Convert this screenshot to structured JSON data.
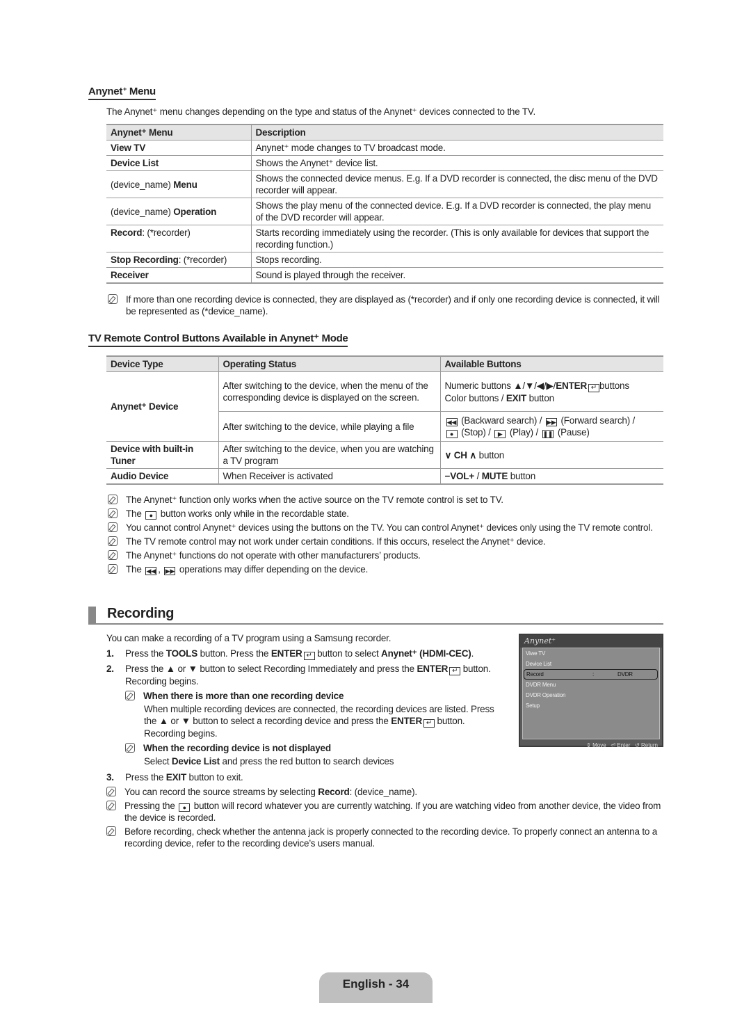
{
  "anynet_menu": {
    "title": "Anynet",
    "title_suffix": "Menu",
    "intro": "The Anynet⁺ menu changes depending on the type and status of the Anynet⁺ devices connected to the TV.",
    "table": {
      "headers": [
        "Anynet⁺ Menu",
        "Description"
      ],
      "rows": [
        {
          "menu_pre": "",
          "menu_bold": "View TV",
          "menu_post": "",
          "desc": "Anynet⁺ mode changes to TV broadcast mode."
        },
        {
          "menu_pre": "",
          "menu_bold": "Device List",
          "menu_post": "",
          "desc": "Shows the Anynet⁺ device list."
        },
        {
          "menu_pre": "(device_name) ",
          "menu_bold": "Menu",
          "menu_post": "",
          "desc": "Shows the connected device menus. E.g. If a DVD recorder is connected, the disc menu of the DVD recorder will appear."
        },
        {
          "menu_pre": "(device_name) ",
          "menu_bold": "Operation",
          "menu_post": "",
          "desc": "Shows the play menu of the connected device. E.g. If a DVD recorder is connected, the play menu of the DVD recorder will appear."
        },
        {
          "menu_pre": "",
          "menu_bold": "Record",
          "menu_post": ": (*recorder)",
          "desc": "Starts recording immediately using the recorder. (This is only available for devices that support the recording function.)"
        },
        {
          "menu_pre": "",
          "menu_bold": "Stop Recording",
          "menu_post": ": (*recorder)",
          "desc": "Stops recording."
        },
        {
          "menu_pre": "",
          "menu_bold": "Receiver",
          "menu_post": "",
          "desc": "Sound is played through the receiver."
        }
      ]
    },
    "note": "If more than one recording device is connected, they are displayed as (*recorder) and if only one recording device is connected, it will be represented as (*device_name)."
  },
  "remote_section": {
    "title": "TV Remote Control Buttons Available in Anynet⁺ Mode",
    "table": {
      "headers": [
        "Device Type",
        "Operating Status",
        "Available Buttons"
      ],
      "anynet_device": "Anynet⁺ Device",
      "status_menu": "After switching to the device, when the menu of the corresponding device is displayed on the screen.",
      "buttons_menu_line1_pre": "Numeric buttons ▲/▼/◀/▶/",
      "buttons_menu_line1_bold": "ENTER",
      "buttons_menu_line1_post": "buttons",
      "buttons_menu_line2_pre": "Color buttons / ",
      "buttons_menu_line2_bold": "EXIT",
      "buttons_menu_line2_post": " button",
      "status_file": "After switching to the device, while playing a file",
      "btn_backward": "(Backward search) /",
      "btn_forward": "(Forward search) /",
      "btn_stop": "(Stop) /",
      "btn_play": "(Play) /",
      "btn_pause": "(Pause)",
      "tuner_device": "Device with built-in Tuner",
      "tuner_status": "After switching to the device, when you are watching a TV program",
      "tuner_ch": "CH",
      "tuner_button": "button",
      "audio_device": "Audio Device",
      "audio_status": "When Receiver is activated",
      "audio_vol": "VOL",
      "audio_sep": " / ",
      "audio_mute": "MUTE",
      "audio_button": " button"
    },
    "notes": [
      "The Anynet⁺ function only works when the active source on the TV remote control is set to TV.",
      "button works only while in the recordable state.",
      "You cannot control Anynet⁺ devices using the buttons on the TV. You can control Anynet⁺ devices only using the TV remote control.",
      "The TV remote control may not work under certain conditions. If this occurs, reselect the Anynet⁺ device.",
      "The Anynet⁺ functions do not operate with other manufacturers’ products.",
      "operations may differ depending on the device."
    ],
    "note_the": "The"
  },
  "recording": {
    "title": "Recording",
    "intro": "You can make a recording of a TV program using a Samsung recorder.",
    "step1": {
      "num": "1.",
      "a": "Press the ",
      "b": "TOOLS",
      "c": " button. Press the ",
      "d": "ENTER",
      "e": " button to select ",
      "f": "Anynet⁺ (HDMI-CEC)",
      "g": "."
    },
    "step2": {
      "num": "2.",
      "a": "Press the ▲ or ▼ button to select Recording Immediately and press the ",
      "b": "ENTER",
      "c": " button. Recording begins."
    },
    "sub1_title": "When there is more than one recording device",
    "sub1_text_a": "When multiple recording devices are connected, the recording devices are listed. Press the ▲ or ▼ button to select a recording device and press the ",
    "sub1_text_b": "ENTER",
    "sub1_text_c": " button. Recording begins.",
    "sub2_title": "When the recording device is not displayed",
    "sub2_text_a": "Select ",
    "sub2_text_b": "Device List",
    "sub2_text_c": " and press the red button to search devices",
    "step3": {
      "num": "3.",
      "a": "Press the ",
      "b": "EXIT",
      "c": " button to exit."
    },
    "note1_a": "You can record the source streams by selecting ",
    "note1_b": "Record",
    "note1_c": ": (device_name).",
    "note2_a": "Pressing the",
    "note2_b": "button will record whatever you are currently watching. If you are watching video from another device, the video from the device is recorded.",
    "note3": "Before recording, check whether the antenna jack is properly connected to the recording device. To properly connect an antenna to a recording device, refer to the recording device’s users manual."
  },
  "osd": {
    "logo": "Anynet⁺",
    "items": [
      "Viwe TV",
      "Device List",
      "Record",
      "DVDR Menu",
      "DVDR Operation",
      "Setup"
    ],
    "selected_sep": ":",
    "selected_value": "DVDR",
    "footer": {
      "move": "Move",
      "enter": "Enter",
      "return": "Return"
    }
  },
  "footer": {
    "page_label": "English - 34"
  }
}
